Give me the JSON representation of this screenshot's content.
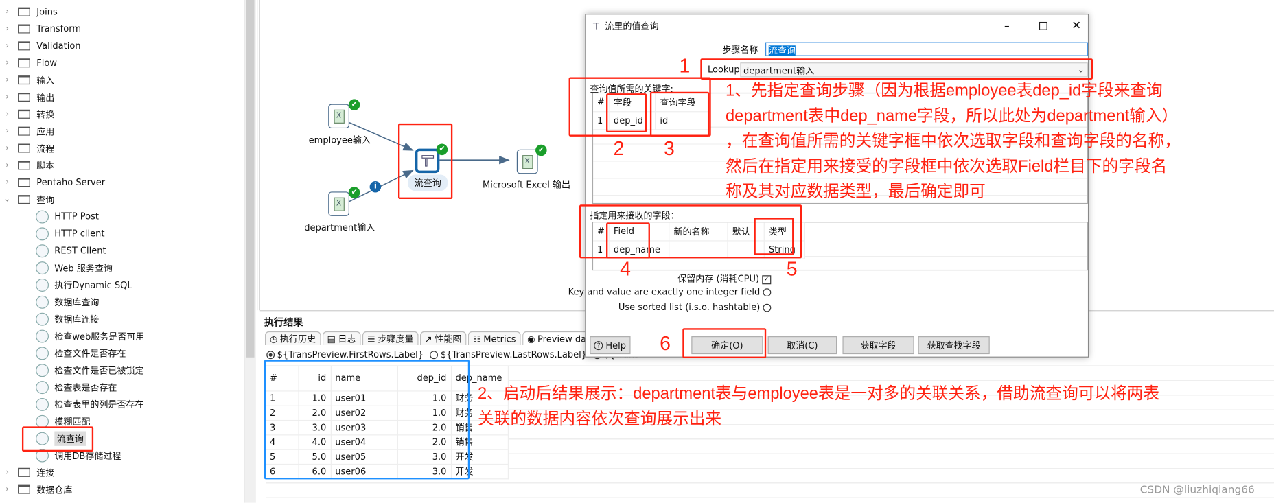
{
  "sidebar": {
    "folders_top": [
      "Joins",
      "Transform",
      "Validation",
      "Flow",
      "输入",
      "输出",
      "转换",
      "应用",
      "流程",
      "脚本",
      "Pentaho Server"
    ],
    "expanded_folder": "查询",
    "children": [
      "HTTP Post",
      "HTTP client",
      "REST Client",
      "Web 服务查询",
      "执行Dynamic SQL",
      "数据库查询",
      "数据库连接",
      "检查web服务是否可用",
      "检查文件是否存在",
      "检查文件是否已被锁定",
      "检查表是否存在",
      "检查表里的列是否存在",
      "模糊匹配",
      "流查询",
      "调用DB存储过程"
    ],
    "selected_child": "流查询",
    "folders_bottom": [
      "连接",
      "数据仓库"
    ]
  },
  "canvas": {
    "nodes": {
      "employee": "employee输入",
      "department": "department输入",
      "lookup": "流查询",
      "excel": "Microsoft Excel 输出"
    },
    "excel_glyph": "X",
    "info_glyph": "i"
  },
  "results": {
    "title": "执行结果",
    "tabs": [
      "执行历史",
      "日志",
      "步骤度量",
      "性能图",
      "Metrics",
      "Preview data"
    ],
    "active_tab": "Preview data",
    "radios": [
      "${TransPreview.FirstRows.Label}",
      "${TransPreview.LastRows.Label}",
      "${Trans"
    ],
    "columns": [
      "#",
      "id",
      "name",
      "dep_id",
      "dep_name"
    ],
    "rows": [
      [
        "1",
        "1.0",
        "user01",
        "1.0",
        "财务"
      ],
      [
        "2",
        "2.0",
        "user02",
        "1.0",
        "财务"
      ],
      [
        "3",
        "3.0",
        "user03",
        "2.0",
        "销售"
      ],
      [
        "4",
        "4.0",
        "user04",
        "2.0",
        "销售"
      ],
      [
        "5",
        "5.0",
        "user05",
        "3.0",
        "开发"
      ],
      [
        "6",
        "6.0",
        "user06",
        "3.0",
        "开发"
      ]
    ]
  },
  "dialog": {
    "title": "流里的值查询",
    "step_name_label": "步骤名称",
    "step_name_value": "流查询",
    "lookup_step_label": "Lookup step",
    "lookup_step_value": "department输入",
    "keys_label": "查询值所需的关键字:",
    "keys_columns": [
      "#",
      "字段",
      "查询字段"
    ],
    "keys_rows": [
      [
        "1",
        "dep_id",
        "id"
      ]
    ],
    "receive_label": "指定用来接收的字段：",
    "receive_columns": [
      "#",
      "Field",
      "新的名称",
      "默认",
      "类型"
    ],
    "receive_rows": [
      [
        "1",
        "dep_name",
        "",
        "",
        "String"
      ]
    ],
    "preserve_memory_label": "保留内存 (消耗CPU)",
    "preserve_memory_checked": true,
    "integer_field_label": "Key and value are exactly one integer field",
    "integer_field_checked": false,
    "sorted_list_label": "Use sorted list (i.s.o. hashtable)",
    "sorted_list_checked": false,
    "buttons": {
      "help": "Help",
      "ok": "确定(O)",
      "cancel": "取消(C)",
      "get_fields": "获取字段",
      "get_lookup_fields": "获取查找字段"
    }
  },
  "annotations": {
    "numbers": [
      "1",
      "2",
      "3",
      "4",
      "5",
      "6"
    ],
    "note1": [
      "1、先指定查询步骤（因为根据employee表dep_id字段来查询",
      "department表中dep_name字段，所以此处为department输入）",
      "，在查询值所需的关键字框中依次选取字段和查询字段的名称，",
      "然后在指定用来接受的字段框中依次选取Field栏目下的字段名",
      "称及其对应数据类型，最后确定即可"
    ],
    "note2": [
      "2、启动后结果展示：department表与employee表是一对多的关联关系，借助流查询可以将两表",
      "关联的数据内容依次查询展示出来"
    ],
    "red": "#ff2211",
    "blue": "#1e90ff"
  },
  "watermark": "CSDN @liuzhiqiang66"
}
